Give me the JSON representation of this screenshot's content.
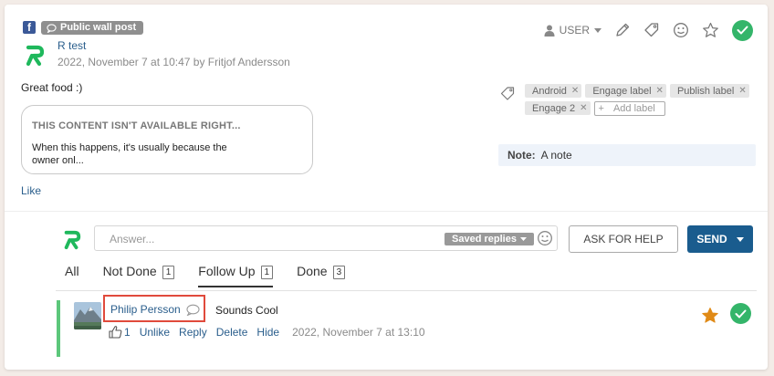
{
  "post": {
    "platform_icon": "facebook-icon",
    "type_label": "Public wall post",
    "author": "R test",
    "meta": "2022, November 7 at 10:47 by Fritjof Andersson",
    "text": "Great food :)",
    "embed": {
      "title": "THIS CONTENT ISN'T AVAILABLE RIGHT...",
      "body": "When this happens, it's usually because the owner onl..."
    },
    "like_label": "Like"
  },
  "toolbar": {
    "user_label": "USER",
    "icons": [
      "user-icon",
      "pencil-icon",
      "tag-icon",
      "smiley-icon",
      "star-icon",
      "check-icon"
    ]
  },
  "labels": {
    "items": [
      "Android",
      "Engage label",
      "Publish label",
      "Engage 2"
    ],
    "add_label": "Add label"
  },
  "note": {
    "prefix": "Note:",
    "text": "A note"
  },
  "reply": {
    "placeholder": "Answer...",
    "saved_replies": "Saved replies",
    "ask_for_help": "ASK FOR HELP",
    "send": "SEND"
  },
  "tabs": [
    {
      "label": "All",
      "count": null
    },
    {
      "label": "Not Done",
      "count": "1"
    },
    {
      "label": "Follow Up",
      "count": "1",
      "active": true
    },
    {
      "label": "Done",
      "count": "3"
    }
  ],
  "comment": {
    "author": "Philip Persson",
    "text": "Sounds Cool",
    "like_count": "1",
    "actions": {
      "unlike": "Unlike",
      "reply": "Reply",
      "delete": "Delete",
      "hide": "Hide"
    },
    "timestamp": "2022, November 7 at 13:10"
  },
  "colors": {
    "accent_green": "#34b56a",
    "brand_green": "#1fb85c",
    "send_blue": "#1a5c8e",
    "star_orange": "#e08a17",
    "highlight_red": "#e04a3c",
    "link_blue": "#2a5e8c"
  }
}
